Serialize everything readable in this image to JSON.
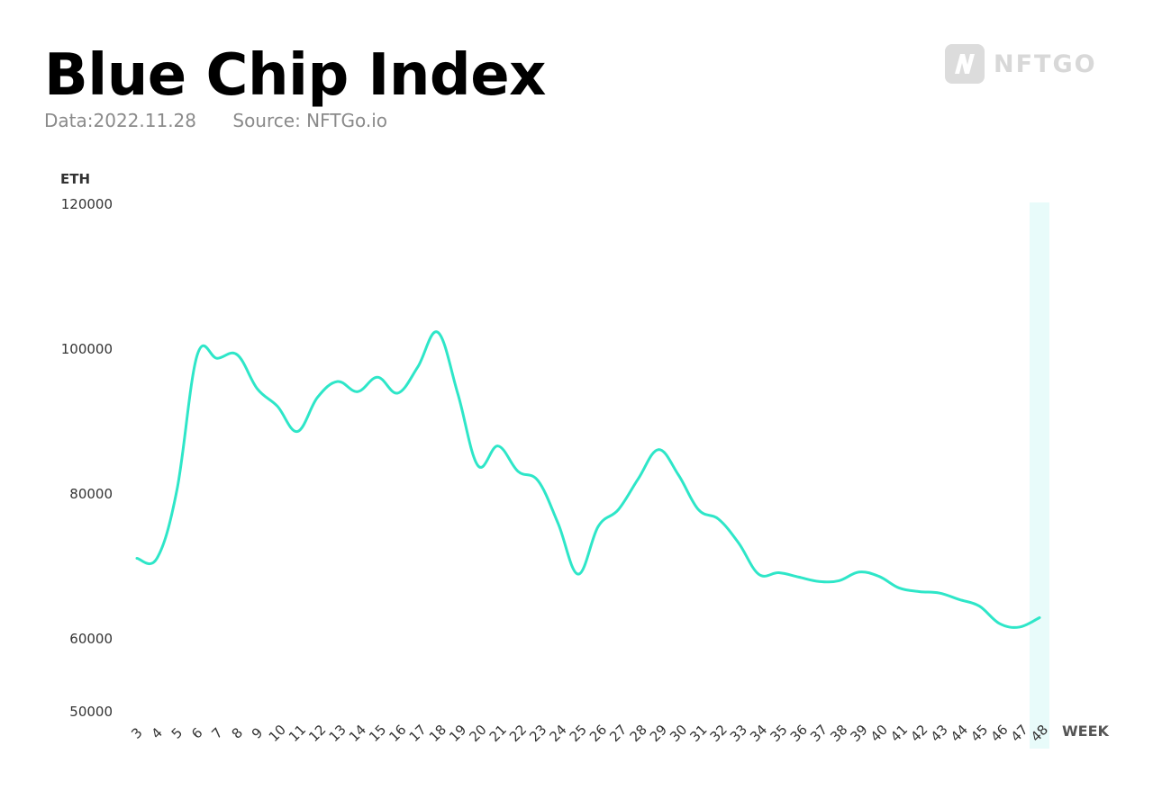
{
  "header": {
    "title": "Blue Chip Index",
    "date": "Data:2022.11.28",
    "source": "Source: NFTGo.io"
  },
  "logo": {
    "icon": "nftgo-logo-icon",
    "text": "NFTGO"
  },
  "colors": {
    "line": "#2EE6C8",
    "highlight": "#E8FBFA",
    "logo": "#D8D8D8"
  },
  "chart_data": {
    "type": "line",
    "title": "Blue Chip Index",
    "xlabel": "WEEK",
    "ylabel": "ETH",
    "yticks": [
      50000,
      60000,
      80000,
      100000,
      120000
    ],
    "ylim": [
      50000,
      120000
    ],
    "grid": false,
    "legend": "none",
    "highlight_category": "48",
    "categories": [
      "3",
      "4",
      "5",
      "6",
      "7",
      "8",
      "9",
      "10",
      "11",
      "12",
      "13",
      "14",
      "15",
      "16",
      "17",
      "18",
      "19",
      "20",
      "21",
      "22",
      "23",
      "24",
      "25",
      "26",
      "27",
      "28",
      "29",
      "30",
      "31",
      "32",
      "33",
      "34",
      "35",
      "36",
      "37",
      "38",
      "39",
      "40",
      "41",
      "42",
      "43",
      "44",
      "45",
      "46",
      "47",
      "48"
    ],
    "series": [
      {
        "name": "Blue Chip Index",
        "values": [
          71000,
          71000,
          80500,
          99000,
          98600,
          99100,
          94400,
          92000,
          88500,
          93200,
          95400,
          94000,
          96000,
          93800,
          97400,
          102200,
          93700,
          83800,
          86500,
          83000,
          81700,
          75800,
          68800,
          75400,
          77700,
          82000,
          86000,
          82500,
          77700,
          76400,
          73100,
          68800,
          69000,
          68400,
          67800,
          67900,
          69100,
          68500,
          66900,
          66400,
          66200,
          65300,
          64400,
          62000,
          61500,
          62800
        ]
      }
    ]
  }
}
